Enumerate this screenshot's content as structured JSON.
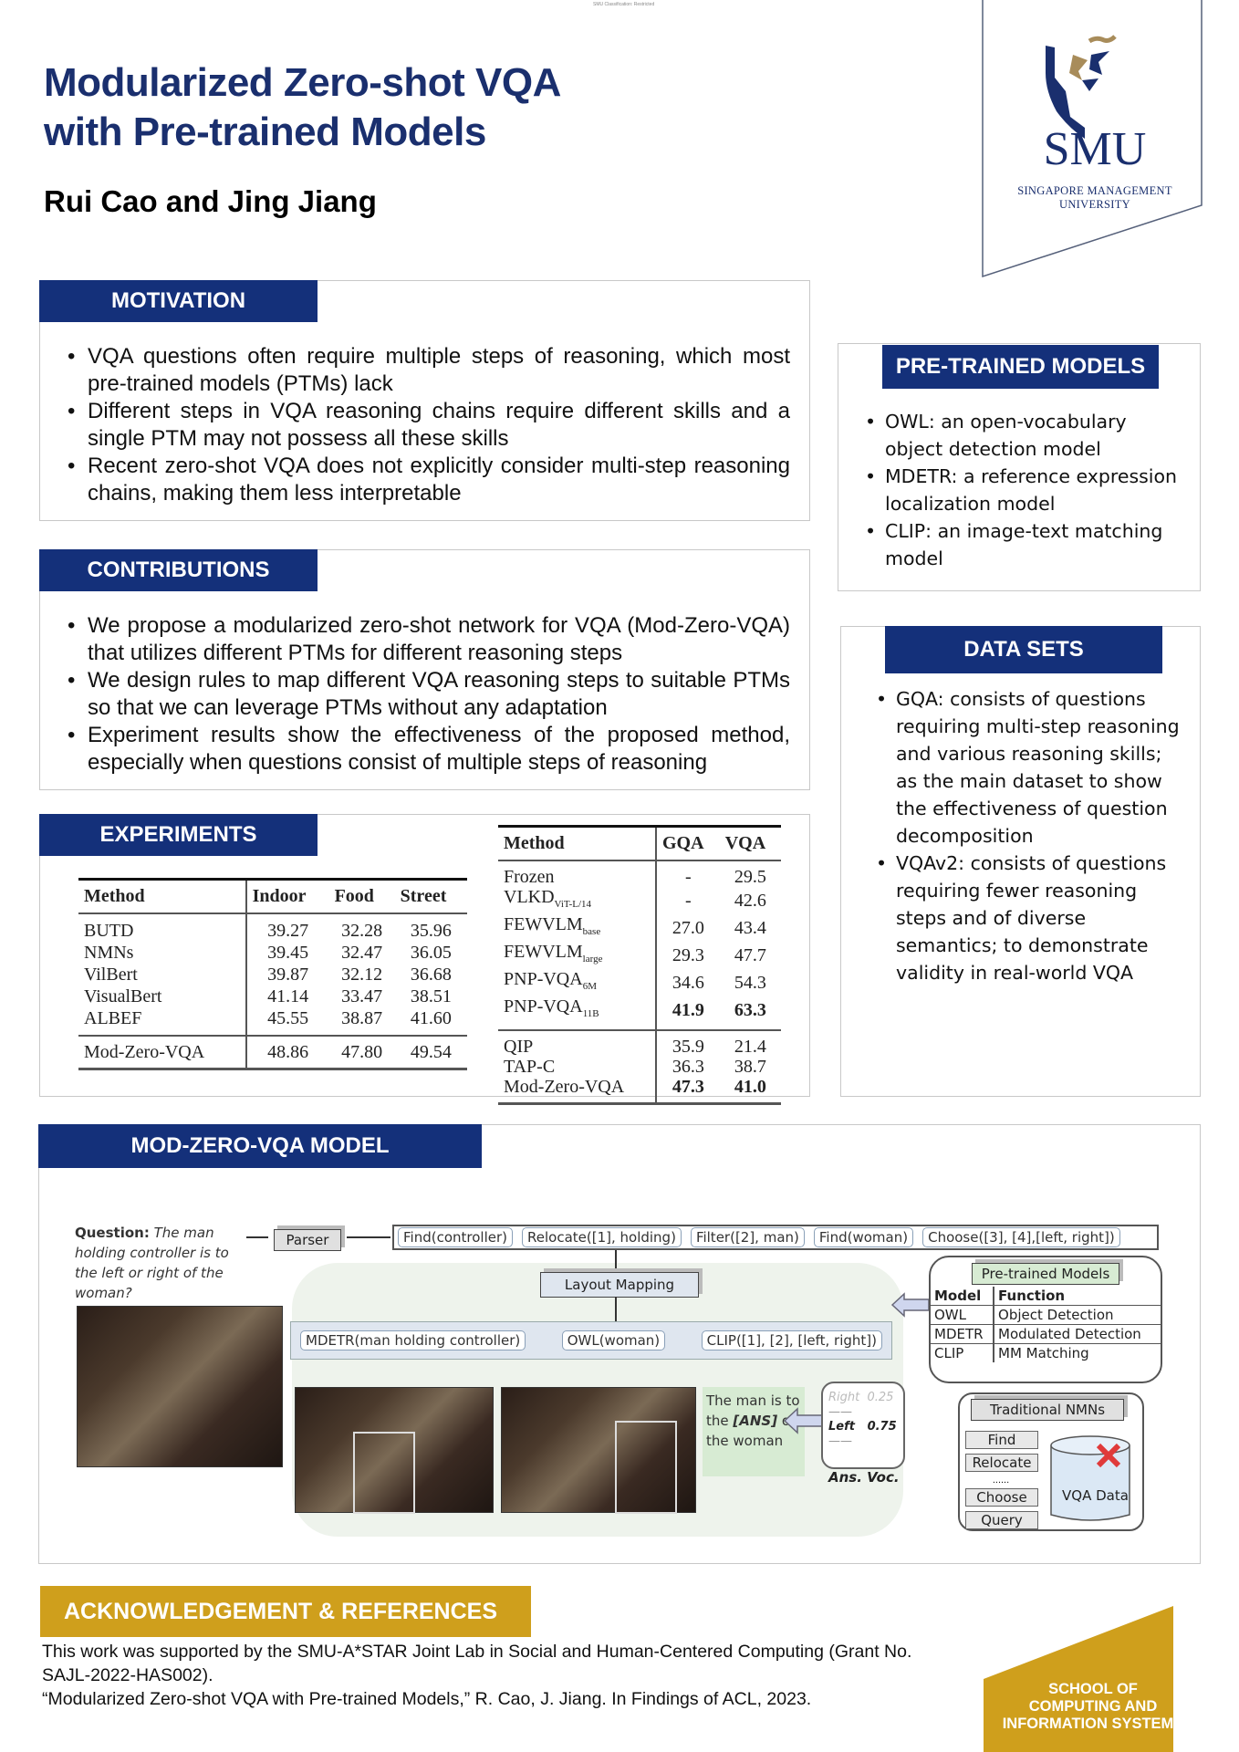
{
  "header": {
    "classification": "SMU Classification: Restricted",
    "title_line1": "Modularized Zero-shot VQA",
    "title_line2": "with Pre-trained Models",
    "authors": "Rui Cao and Jing Jiang"
  },
  "logo": {
    "name": "SMU",
    "subtitle_line1": "SINGAPORE MANAGEMENT",
    "subtitle_line2": "UNIVERSITY",
    "brand_color": "#1a2f6e",
    "accent_color": "#a88c5a"
  },
  "motivation": {
    "heading": "MOTIVATION",
    "bullets": [
      "VQA questions often require multiple steps of reasoning, which most pre-trained models (PTMs) lack",
      "Different steps in VQA reasoning chains require different skills and a single PTM may not possess all these skills",
      "Recent zero-shot VQA does not explicitly consider multi-step reasoning chains, making them less interpretable"
    ]
  },
  "contributions": {
    "heading": "CONTRIBUTIONS",
    "bullets": [
      "We propose a modularized zero-shot network for VQA  (Mod-Zero-VQA) that utilizes different PTMs for different reasoning steps",
      "We design rules to map different VQA reasoning steps to suitable PTMs so that we can leverage PTMs without any adaptation",
      "Experiment results show the effectiveness of the proposed method, especially when questions consist of multiple steps of reasoning"
    ]
  },
  "pretrained_models": {
    "heading": "PRE-TRAINED MODELS",
    "bullets": [
      "OWL: an open-vocabulary object detection model",
      "MDETR: a reference expression localization model",
      "CLIP: an image-text matching model"
    ]
  },
  "datasets": {
    "heading": "DATA SETS",
    "bullets": [
      "GQA: consists of questions requiring multi-step reasoning and various reasoning skills; as the main dataset to show the effectiveness of question decomposition",
      "VQAv2: consists of questions requiring fewer reasoning steps and of diverse semantics; to demonstrate validity in real-world VQA"
    ]
  },
  "experiments": {
    "heading": "EXPERIMENTS",
    "table1": {
      "columns": [
        "Method",
        "Indoor",
        "Food",
        "Street"
      ],
      "rows": [
        [
          "BUTD",
          "39.27",
          "32.28",
          "35.96"
        ],
        [
          "NMNs",
          "39.45",
          "32.47",
          "36.05"
        ],
        [
          "VilBert",
          "39.87",
          "32.12",
          "36.68"
        ],
        [
          "VisualBert",
          "41.14",
          "33.47",
          "38.51"
        ],
        [
          "ALBEF",
          "45.55",
          "38.87",
          "41.60"
        ]
      ],
      "final_row": [
        "Mod-Zero-VQA",
        "48.86",
        "47.80",
        "49.54"
      ]
    },
    "table2": {
      "columns": [
        "Method",
        "GQA",
        "VQA"
      ],
      "group1": [
        {
          "name": "Frozen",
          "sub": "",
          "gqa": "-",
          "vqa": "29.5"
        },
        {
          "name": "VLKD",
          "sub": "ViT-L/14",
          "gqa": "-",
          "vqa": "42.6"
        },
        {
          "name": "FEWVLM",
          "sub": "base",
          "gqa": "27.0",
          "vqa": "43.4"
        },
        {
          "name": "FEWVLM",
          "sub": "large",
          "gqa": "29.3",
          "vqa": "47.7"
        },
        {
          "name": "PNP-VQA",
          "sub": "6M",
          "gqa": "34.6",
          "vqa": "54.3"
        },
        {
          "name": "PNP-VQA",
          "sub": "11B",
          "gqa": "41.9",
          "vqa": "63.3"
        }
      ],
      "group2": [
        {
          "name": "QIP",
          "sub": "",
          "gqa": "35.9",
          "vqa": "21.4"
        },
        {
          "name": "TAP-C",
          "sub": "",
          "gqa": "36.3",
          "vqa": "38.7"
        },
        {
          "name": "Mod-Zero-VQA",
          "sub": "",
          "gqa": "47.3",
          "vqa": "41.0"
        }
      ]
    }
  },
  "model": {
    "heading": "MOD-ZERO-VQA MODEL",
    "question_label": "Question:",
    "question_text": "The man holding controller is to the left or right of the woman?",
    "parser": "Parser",
    "chain": [
      "Find(controller)",
      "Relocate([1], holding)",
      "Filter([2], man)",
      "Find(woman)",
      "Choose([3], [4],[left, right])"
    ],
    "layout_mapping": "Layout Mapping",
    "modules": [
      "MDETR(man holding controller)",
      "OWL(woman)",
      "CLIP([1], [2], [left, right])"
    ],
    "template_text_parts": [
      "The man is to the ",
      "[ANS]",
      " of the woman"
    ],
    "answers": [
      {
        "label": "Right",
        "score": "0.25"
      },
      {
        "label": "Left",
        "score": "0.75"
      }
    ],
    "ans_voc_label": "Ans. Voc.",
    "ptm_table": {
      "title": "Pre-trained Models",
      "columns": [
        "Model",
        "Function"
      ],
      "rows": [
        [
          "OWL",
          "Object Detection"
        ],
        [
          "MDETR",
          "Modulated Detection"
        ],
        [
          "CLIP",
          "MM Matching"
        ]
      ]
    },
    "nmn": {
      "title": "Traditional NMNs",
      "modules": [
        "Find",
        "Relocate",
        "......",
        "Choose",
        "Query"
      ],
      "data_label": "VQA Data"
    }
  },
  "acknowledgement": {
    "heading": "ACKNOWLEDGEMENT & REFERENCES",
    "lines": [
      "This work was supported by the SMU-A*STAR Joint Lab in Social and Human-Centered Computing (Grant No. SAJL-2022-HAS002).",
      "“Modularized Zero-shot VQA with Pre-trained Models,” R. Cao, J. Jiang. In Findings of ACL, 2023."
    ],
    "accent_color": "#cf9f1c"
  },
  "school": {
    "line1": "SCHOOL OF",
    "line2": "COMPUTING AND",
    "line3": "INFORMATION SYSTEMS"
  }
}
